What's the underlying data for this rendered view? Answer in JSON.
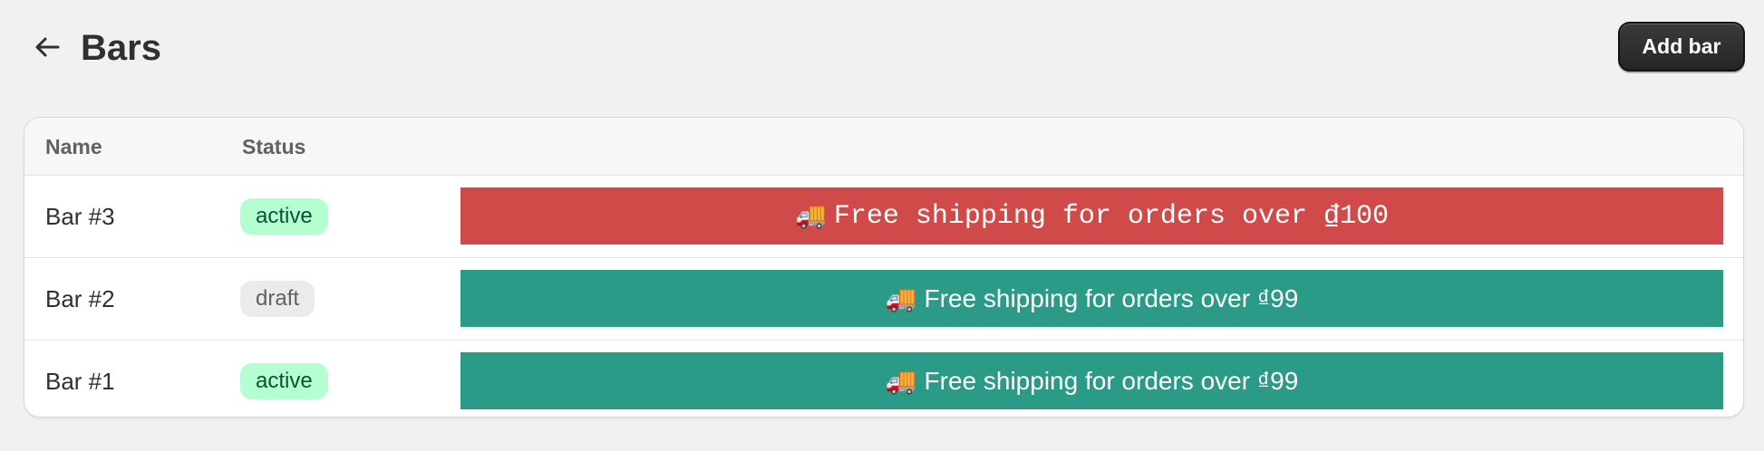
{
  "header": {
    "title": "Bars",
    "back_icon": "arrow-left-icon",
    "add_button_label": "Add bar"
  },
  "table": {
    "columns": [
      "Name",
      "Status",
      ""
    ],
    "rows": [
      {
        "name": "Bar #3",
        "status": "active",
        "bar_icon": "🚚",
        "bar_text": "Free shipping for orders over ₫100",
        "bar_color": "#d04a4a",
        "bar_font": "monospace"
      },
      {
        "name": "Bar #2",
        "status": "draft",
        "bar_icon": "🚚",
        "bar_text": "Free shipping for orders over ₫99",
        "bar_color": "#2b9a87",
        "bar_font": "sans-serif"
      },
      {
        "name": "Bar #1",
        "status": "active",
        "bar_icon": "🚚",
        "bar_text": "Free shipping for orders over ₫99",
        "bar_color": "#2b9a87",
        "bar_font": "sans-serif"
      }
    ]
  },
  "colors": {
    "page_background": "#f1f1f1",
    "primary_button": "#303030",
    "badge_active_bg": "#b4fed2",
    "badge_draft_bg": "#ebebeb"
  }
}
